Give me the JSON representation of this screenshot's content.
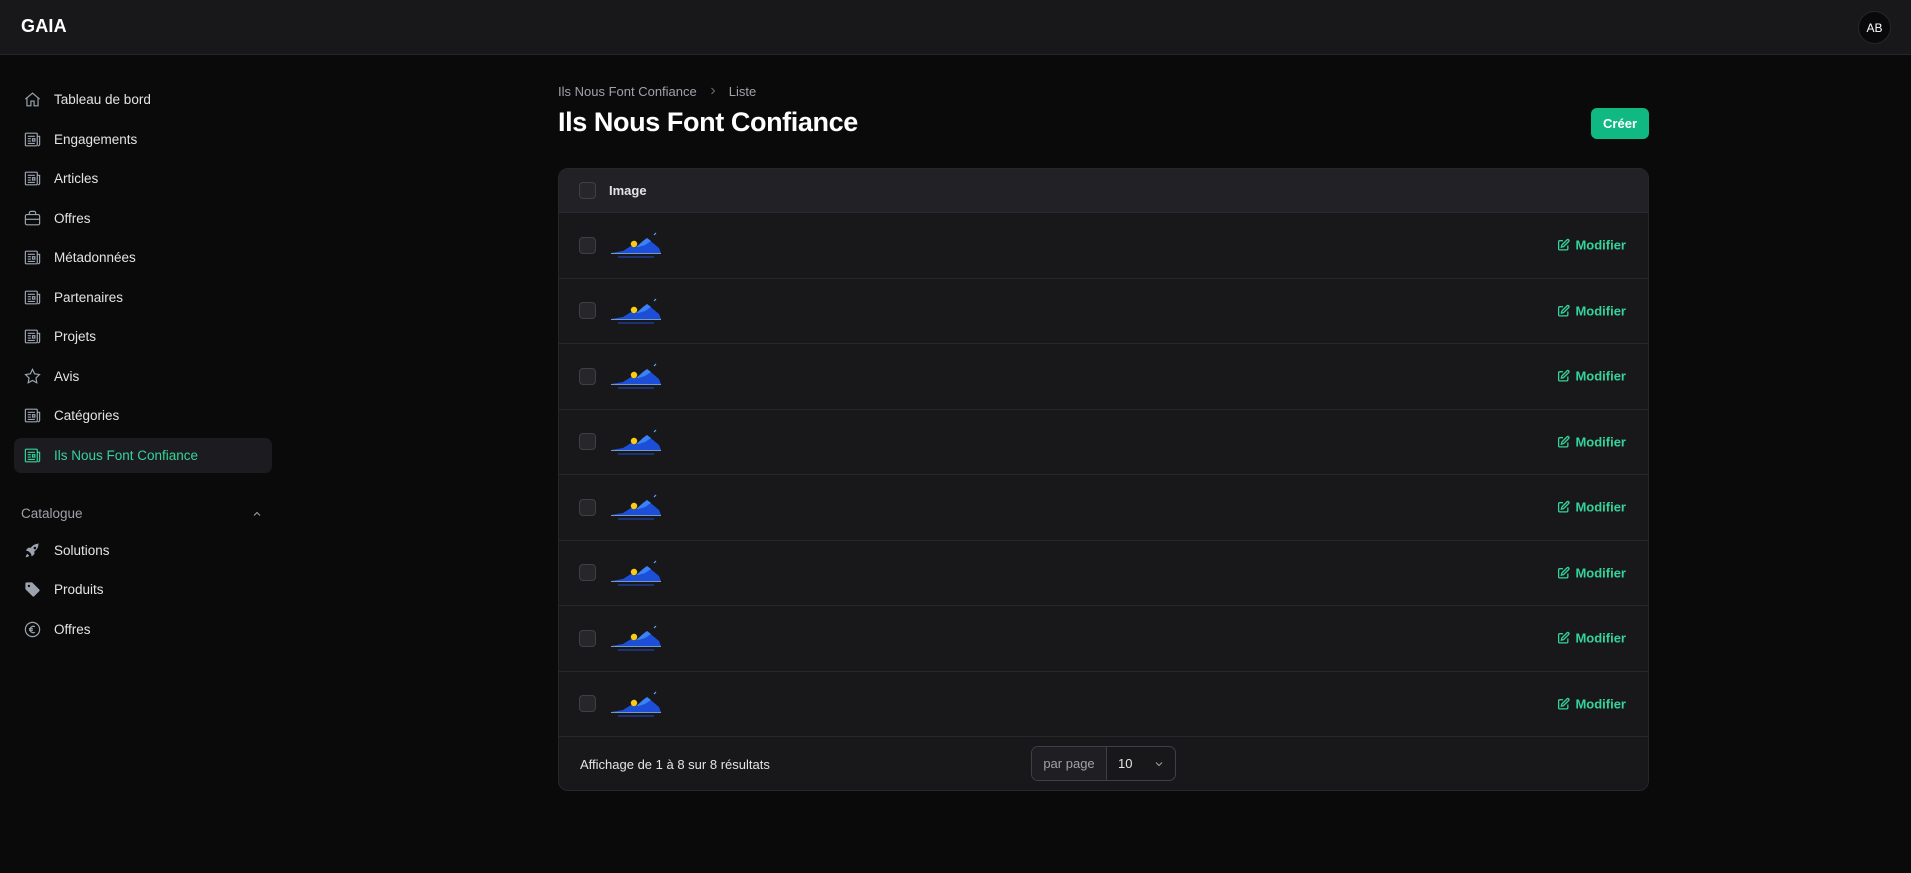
{
  "app": {
    "brand": "GAIA",
    "user_initials": "AB"
  },
  "sidebar": {
    "items": [
      {
        "label": "Tableau de bord",
        "icon": "home-icon"
      },
      {
        "label": "Engagements",
        "icon": "newspaper-icon"
      },
      {
        "label": "Articles",
        "icon": "newspaper-icon"
      },
      {
        "label": "Offres",
        "icon": "briefcase-icon"
      },
      {
        "label": "Métadonnées",
        "icon": "newspaper-icon"
      },
      {
        "label": "Partenaires",
        "icon": "newspaper-icon"
      },
      {
        "label": "Projets",
        "icon": "newspaper-icon"
      },
      {
        "label": "Avis",
        "icon": "star-icon"
      },
      {
        "label": "Catégories",
        "icon": "newspaper-icon"
      },
      {
        "label": "Ils Nous Font Confiance",
        "icon": "newspaper-icon",
        "active": true
      }
    ],
    "group": {
      "label": "Catalogue",
      "items": [
        {
          "label": "Solutions",
          "icon": "rocket-icon"
        },
        {
          "label": "Produits",
          "icon": "tag-icon"
        },
        {
          "label": "Offres",
          "icon": "euro-icon"
        }
      ]
    }
  },
  "breadcrumb": {
    "parent": "Ils Nous Font Confiance",
    "current": "Liste"
  },
  "page": {
    "title": "Ils Nous Font Confiance",
    "create_label": "Créer"
  },
  "table": {
    "column_header": "Image",
    "edit_label": "Modifier",
    "row_count": 8
  },
  "footer": {
    "summary": "Affichage de 1 à 8 sur 8 résultats",
    "per_page_label": "par page",
    "per_page_value": "10"
  },
  "colors": {
    "accent": "#10b981",
    "accent_text": "#34d399",
    "background": "#0a0a0b",
    "surface": "#18181b"
  }
}
